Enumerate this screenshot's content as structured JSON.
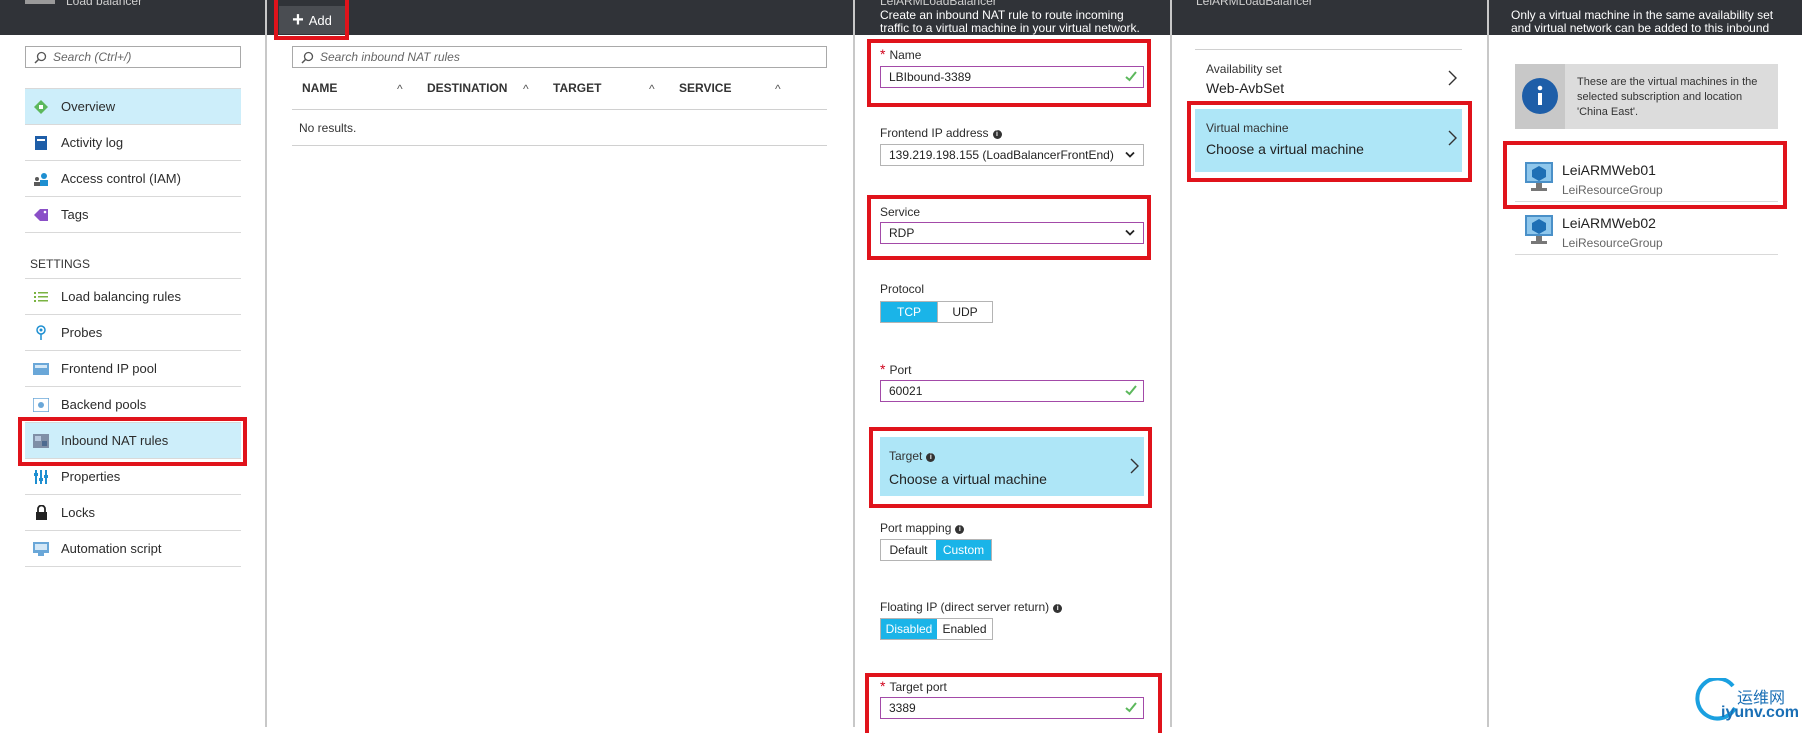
{
  "topbar": {
    "blade1_title": "Load balancer",
    "add_label": "Add",
    "blade3_title": "LeiARMLoadBalancer",
    "blade3_desc_line1": "Create an inbound NAT rule to route incoming",
    "blade3_desc_line2": "traffic to a virtual machine in your virtual network.",
    "blade4_title": "LeiARMLoadBalancer",
    "blade5_line1": "Only a virtual machine in the same availability set",
    "blade5_line2": "and virtual network can be added to this inbound"
  },
  "sidebar": {
    "search_placeholder": "Search (Ctrl+/)",
    "items_top": [
      {
        "label": "Overview",
        "icon": "overview-icon"
      },
      {
        "label": "Activity log",
        "icon": "activity-log-icon"
      },
      {
        "label": "Access control (IAM)",
        "icon": "iam-icon"
      },
      {
        "label": "Tags",
        "icon": "tag-icon"
      }
    ],
    "section_label": "SETTINGS",
    "items_settings": [
      {
        "label": "Load balancing rules",
        "icon": "list-icon"
      },
      {
        "label": "Probes",
        "icon": "probe-icon"
      },
      {
        "label": "Frontend IP pool",
        "icon": "frontend-icon"
      },
      {
        "label": "Backend pools",
        "icon": "backend-icon"
      },
      {
        "label": "Inbound NAT rules",
        "icon": "nat-icon"
      },
      {
        "label": "Properties",
        "icon": "properties-icon"
      },
      {
        "label": "Locks",
        "icon": "lock-icon"
      },
      {
        "label": "Automation script",
        "icon": "script-icon"
      }
    ]
  },
  "rules_list": {
    "search_placeholder": "Search inbound NAT rules",
    "columns": [
      "NAME",
      "DESTINATION",
      "TARGET",
      "SERVICE"
    ],
    "empty_text": "No results."
  },
  "form": {
    "name_label": "Name",
    "name_value": "LBIbound-3389",
    "frontend_label": "Frontend IP address",
    "frontend_value": "139.219.198.155 (LoadBalancerFrontEnd)",
    "service_label": "Service",
    "service_value": "RDP",
    "protocol_label": "Protocol",
    "protocol_options": [
      "TCP",
      "UDP"
    ],
    "protocol_selected": "TCP",
    "port_label": "Port",
    "port_value": "60021",
    "target_label": "Target",
    "target_value": "Choose a virtual machine",
    "port_mapping_label": "Port mapping",
    "port_mapping_options": [
      "Default",
      "Custom"
    ],
    "port_mapping_selected": "Custom",
    "floating_ip_label": "Floating IP (direct server return)",
    "floating_ip_options": [
      "Disabled",
      "Enabled"
    ],
    "floating_ip_selected": "Disabled",
    "target_port_label": "Target port",
    "target_port_value": "3389"
  },
  "blade4": {
    "avset_label": "Availability set",
    "avset_value": "Web-AvbSet",
    "vm_label": "Virtual machine",
    "vm_value": "Choose a virtual machine"
  },
  "blade5": {
    "info_text": "These are the virtual machines in the selected subscription and location 'China East'.",
    "vms": [
      {
        "name": "LeiARMWeb01",
        "group": "LeiResourceGroup"
      },
      {
        "name": "LeiARMWeb02",
        "group": "LeiResourceGroup"
      }
    ]
  },
  "watermark": {
    "text_cn": "运维网",
    "text_url": "iyunv.com"
  },
  "colors": {
    "accent": "#1ab4e8",
    "selected": "#cdeefa",
    "tile": "#aee6f7",
    "highlight_box": "#e0131b",
    "topbar": "#303338"
  }
}
